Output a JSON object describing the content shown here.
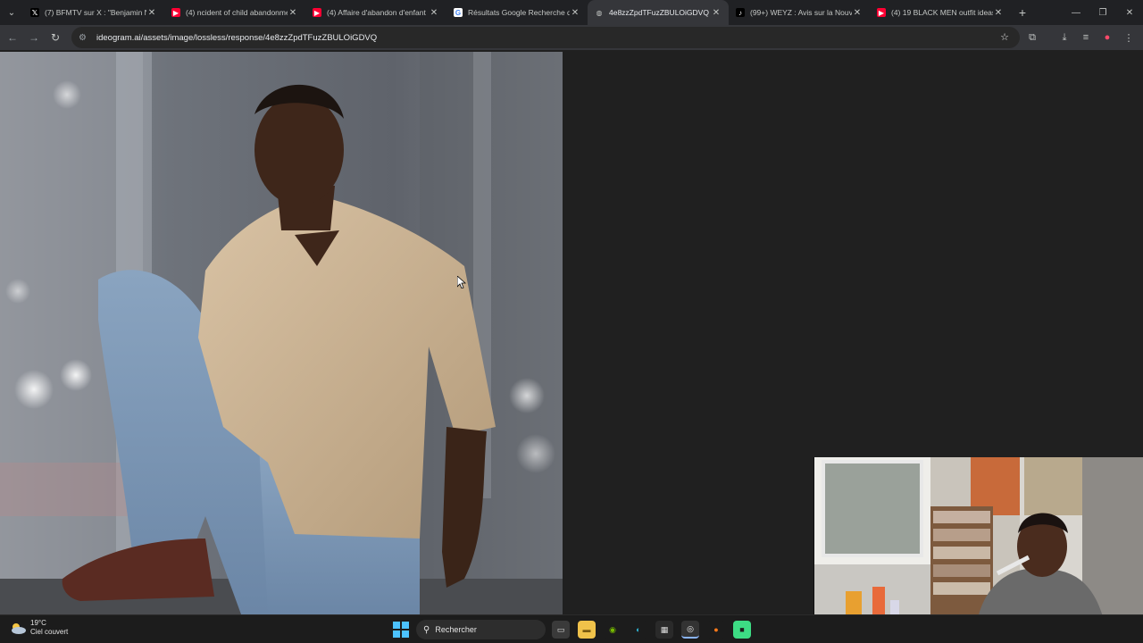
{
  "tabs": [
    {
      "favicon": "x-logo-icon",
      "title": "(7) BFMTV sur X : \"Benjamin Ne",
      "active": false
    },
    {
      "favicon": "youtube-icon",
      "title": "(4) ncident of child abandonme",
      "active": false
    },
    {
      "favicon": "youtube-icon",
      "title": "(4) Affaire d'abandon d'enfant",
      "active": false
    },
    {
      "favicon": "google-icon",
      "title": "Résultats Google Recherche d'i",
      "active": false
    },
    {
      "favicon": "globe-icon",
      "title": "4e8zzZpdTFuzZBULOiGDVQ (1",
      "active": true
    },
    {
      "favicon": "tiktok-icon",
      "title": "(99+) WEYZ : Avis sur la Nouve",
      "active": false
    },
    {
      "favicon": "youtube-icon",
      "title": "(4) 19 BLACK MEN outfit ideas",
      "active": false
    }
  ],
  "address_bar": {
    "url": "ideogram.ai/assets/image/lossless/response/4e8zzZpdTFuzZBULOiGDVQ"
  },
  "taskbar": {
    "weather_temp": "19°C",
    "weather_desc": "Ciel couvert",
    "search_placeholder": "Rechercher",
    "apps": [
      "task-view",
      "file-explorer",
      "nvidia",
      "edge",
      "store",
      "chrome",
      "firefox",
      "app"
    ]
  },
  "colors": {
    "youtube": "#ff0033",
    "accent": "#8ab4f8",
    "page_bg": "#202020"
  }
}
